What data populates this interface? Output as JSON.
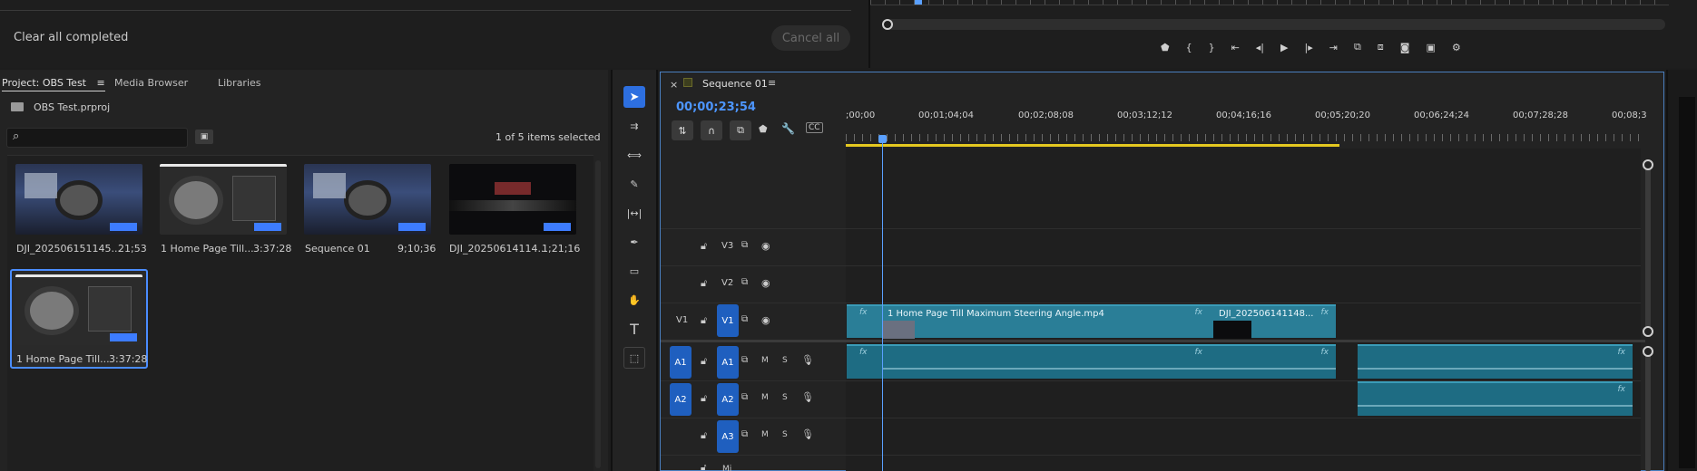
{
  "export_queue": {
    "clear_all_label": "Clear all completed",
    "cancel_all_label": "Cancel all"
  },
  "project_panel": {
    "tabs": [
      "Project: OBS Test",
      "Media Browser",
      "Libraries"
    ],
    "project_file": "OBS Test.prproj",
    "search_placeholder": "",
    "selection_status": "1 of 5 items selected",
    "items": [
      {
        "name": "DJI_202506151145...",
        "duration": "21;53"
      },
      {
        "name": "1 Home Page Till...",
        "duration": "3:37:28"
      },
      {
        "name": "Sequence 01",
        "duration": "9;10;36"
      },
      {
        "name": "DJI_20250614114...",
        "duration": "1;21;16"
      },
      {
        "name": "1 Home Page Till...",
        "duration": "3:37:28"
      }
    ]
  },
  "timeline": {
    "sequence_name": "Sequence 01",
    "timecode": "00;00;23;54",
    "ruler_labels": [
      ";00;00",
      "00;01;04;04",
      "00;02;08;08",
      "00;03;12;12",
      "00;04;16;16",
      "00;05;20;20",
      "00;06;24;24",
      "00;07;28;28",
      "00;08;3"
    ],
    "video_tracks": [
      {
        "name": "V3"
      },
      {
        "name": "V2"
      },
      {
        "name": "V1",
        "source": "V1"
      }
    ],
    "audio_tracks": [
      {
        "name": "A1",
        "source": "A1",
        "m": "M",
        "s": "S"
      },
      {
        "name": "A2",
        "source": "A2",
        "m": "M",
        "s": "S"
      },
      {
        "name": "A3",
        "m": "M",
        "s": "S"
      }
    ],
    "clips": {
      "v1_main": "1 Home Page Till Maximum Steering Angle.mp4",
      "v1_second": "DJI_202506141148...",
      "fx": "fx"
    },
    "bottom_partial": "Mi"
  },
  "colors": {
    "accent": "#2d8ceb",
    "clip": "#2a7e97",
    "track_btn": "#1f5fbf",
    "playhead": "#5aa0ff",
    "work_area": "#e4c820"
  }
}
